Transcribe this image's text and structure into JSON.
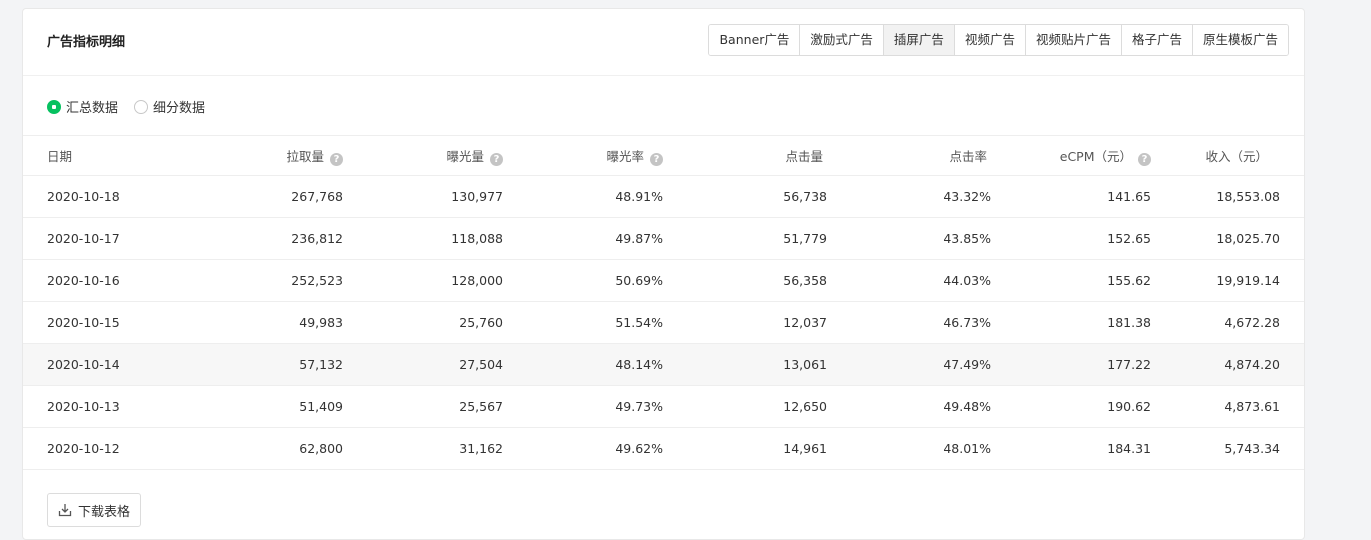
{
  "card": {
    "title": "广告指标明细"
  },
  "tabs": [
    {
      "label": "Banner广告"
    },
    {
      "label": "激励式广告"
    },
    {
      "label": "插屏广告",
      "active": true
    },
    {
      "label": "视频广告"
    },
    {
      "label": "视频贴片广告"
    },
    {
      "label": "格子广告"
    },
    {
      "label": "原生模板广告"
    }
  ],
  "radios": [
    {
      "label": "汇总数据",
      "checked": true
    },
    {
      "label": "细分数据",
      "checked": false
    }
  ],
  "table": {
    "headers": [
      "日期",
      "拉取量",
      "曝光量",
      "曝光率",
      "点击量",
      "点击率",
      "eCPM（元）",
      "收入（元）"
    ],
    "rows": [
      [
        "2020-10-18",
        "267,768",
        "130,977",
        "48.91%",
        "56,738",
        "43.32%",
        "141.65",
        "18,553.08"
      ],
      [
        "2020-10-17",
        "236,812",
        "118,088",
        "49.87%",
        "51,779",
        "43.85%",
        "152.65",
        "18,025.70"
      ],
      [
        "2020-10-16",
        "252,523",
        "128,000",
        "50.69%",
        "56,358",
        "44.03%",
        "155.62",
        "19,919.14"
      ],
      [
        "2020-10-15",
        "49,983",
        "25,760",
        "51.54%",
        "12,037",
        "46.73%",
        "181.38",
        "4,672.28"
      ],
      [
        "2020-10-14",
        "57,132",
        "27,504",
        "48.14%",
        "13,061",
        "47.49%",
        "177.22",
        "4,874.20"
      ],
      [
        "2020-10-13",
        "51,409",
        "25,567",
        "49.73%",
        "12,650",
        "49.48%",
        "190.62",
        "4,873.61"
      ],
      [
        "2020-10-12",
        "62,800",
        "31,162",
        "49.62%",
        "14,961",
        "48.01%",
        "184.31",
        "5,743.34"
      ]
    ]
  },
  "download": {
    "label": "下载表格",
    "icon": "download-icon"
  },
  "colors": {
    "accent": "#07c160",
    "help_icon": "#c4c4c4"
  }
}
